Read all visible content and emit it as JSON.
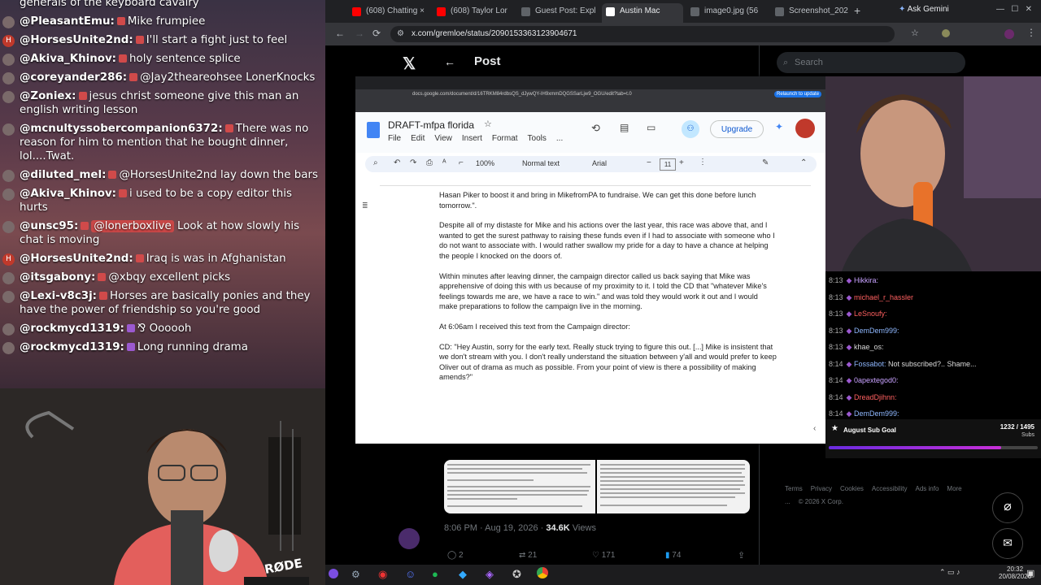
{
  "stream_chat": [
    {
      "user": "",
      "msg": "generals of the keyboard cavalry",
      "color": "#ffffff",
      "icon": ""
    },
    {
      "user": "@PleasantEmu:",
      "msg": "Mike frumpiee",
      "color": "#ffffff",
      "icon": "avatar"
    },
    {
      "user": "@HorsesUnite2nd:",
      "msg": "I'll start a fight just to feel",
      "color": "#ffffff",
      "icon": "H"
    },
    {
      "user": "@Akiva_Khinov:",
      "msg": "holy sentence splice",
      "color": "#ffffff",
      "icon": "avatar"
    },
    {
      "user": "@coreyander286:",
      "msg": "@Jay2theareohsee LonerKnocks",
      "color": "#ffffff",
      "icon": "avatar"
    },
    {
      "user": "@Zoniex:",
      "msg": "jesus christ someone give this man an english writing lesson",
      "color": "#ffffff",
      "icon": "avatar"
    },
    {
      "user": "@mcnultyssobercompanion6372:",
      "msg": "There was no reason for him to mention that he bought dinner, lol....Twat.",
      "color": "#ffffff",
      "icon": "avatar"
    },
    {
      "user": "@diluted_mel:",
      "msg": "@HorsesUnite2nd lay down the bars",
      "color": "#ffffff",
      "icon": "avatar"
    },
    {
      "user": "@Akiva_Khinov:",
      "msg": "i used to be a copy editor this hurts",
      "color": "#ffffff",
      "icon": "avatar"
    },
    {
      "user": "@unsc95:",
      "msg": "Look at how slowly his chat is moving",
      "mention": "@lonerboxlive",
      "color": "#ffffff",
      "icon": "avatar"
    },
    {
      "user": "@HorsesUnite2nd:",
      "msg": "Iraq is was in Afghanistan",
      "color": "#ffffff",
      "icon": "H"
    },
    {
      "user": "@itsgabony:",
      "msg": "@xbqy excellent picks",
      "color": "#ffffff",
      "icon": "avatar"
    },
    {
      "user": "@Lexi-v8c3j:",
      "msg": "Horses are basically ponies and they have the power of friendship so you're good",
      "color": "#ffffff",
      "icon": "avatar"
    },
    {
      "user": "@rockmycd1319:",
      "msg": "⅋ Oooooh",
      "color": "#ffffff",
      "icon": "avatar"
    },
    {
      "user": "@rockmycd1319:",
      "msg": "Long running drama",
      "color": "#ffffff",
      "icon": "avatar"
    }
  ],
  "browser": {
    "tabs": [
      {
        "label": "(608) Chatting ×",
        "fav": "#ff0000"
      },
      {
        "label": "(608) Taylor Lor",
        "fav": "#ff0000"
      },
      {
        "label": "Guest Post: Expl",
        "fav": "#5f6368"
      },
      {
        "label": "Austin Mac",
        "fav": "#ffffff",
        "active": true
      },
      {
        "label": "image0.jpg (56",
        "fav": "#5f6368"
      },
      {
        "label": "Screenshot_202",
        "fav": "#5f6368"
      }
    ],
    "new_tab": "+",
    "ask_gemini": "Ask Gemini",
    "url": "x.com/gremloe/status/2090153363123904671"
  },
  "x_page": {
    "title": "Post",
    "search_placeholder": "Search",
    "post_time": "8:06 PM · Aug 19, 2026 ·",
    "views": "34.6K",
    "views_label": "Views",
    "replies": "2",
    "reposts": "21",
    "likes": "171",
    "bookmarks": "74",
    "footer": [
      "Terms",
      "Privacy",
      "Cookies",
      "Accessibility",
      "Ads info",
      "More ...",
      "© 2026 X Corp."
    ]
  },
  "docs": {
    "url": "docs.google.com/document/d/16TRKM84rdbsQS_dJywQY-IH9xmmDQGSSarLjw9_OGU/edit?tab=t.0",
    "relaunch": "Relaunch to update",
    "doc_title": "DRAFT-mfpa florida",
    "menus": [
      "File",
      "Edit",
      "View",
      "Insert",
      "Format",
      "Tools",
      "..."
    ],
    "upgrade": "Upgrade",
    "zoom": "100%",
    "style": "Normal text",
    "font": "Arial",
    "size": "11",
    "paragraphs": [
      "Hasan Piker to boost it and bring in MikefromPA to fundraise. We can get this done before lunch tomorrow.\".",
      "Despite all of my distaste for Mike and his actions over the last year, this race was above that, and I wanted to get the surest pathway to raising these funds even if I had to associate with someone who I do not want to associate with. I would rather swallow my pride for a day to have a chance at helping the people I knocked on the doors of.",
      "Within minutes after leaving dinner, the campaign director called us back saying that Mike was apprehensive of doing this with us because of my proximity to it. I told the CD that \"whatever Mike's feelings towards me are, we have a race to win.\" and was told they would work it out and I would make preparations to follow the campaign live in the morning.",
      "At 6:06am I received this text from the Campaign director:",
      "CD: \"Hey Austin, sorry for the early text.  Really stuck trying to figure this out. [...] Mike is insistent that we don't stream with you. I don't really understand the situation between y'all and would prefer to keep Oliver out of drama as much as possible. From your point of view is there a possibility of making amends?\""
    ]
  },
  "right_chat": [
    {
      "time": "8:13",
      "user": "Hikkira:",
      "color": "#c8a2ff"
    },
    {
      "time": "8:13",
      "user": "michael_r_hassler",
      "color": "#ff6060"
    },
    {
      "time": "8:13",
      "user": "LeSnoufy:",
      "color": "#ff6060"
    },
    {
      "time": "8:13",
      "user": "DemDem999:",
      "color": "#8fb8ff"
    },
    {
      "time": "8:13",
      "user": "khae_os:",
      "color": "#d8d8d8"
    },
    {
      "time": "8:14",
      "user": "Fossabot:",
      "color": "#8fb8ff",
      "msg": "Not subscribed?.. Shame..."
    },
    {
      "time": "8:14",
      "user": "0apextegod0:",
      "color": "#c8a2ff"
    },
    {
      "time": "8:14",
      "user": "DreadDjihnn:",
      "color": "#ff6060"
    },
    {
      "time": "8:14",
      "user": "DemDem999:",
      "color": "#8fb8ff"
    }
  ],
  "sub_goal": {
    "label": "August Sub Goal",
    "count": "1232 / 1495",
    "unit": "Subs",
    "progress": 0.824
  },
  "taskbar": {
    "time": "20:32",
    "date": "20/08/2026"
  },
  "webcam_left": {
    "mic_brand": "RØDE"
  }
}
